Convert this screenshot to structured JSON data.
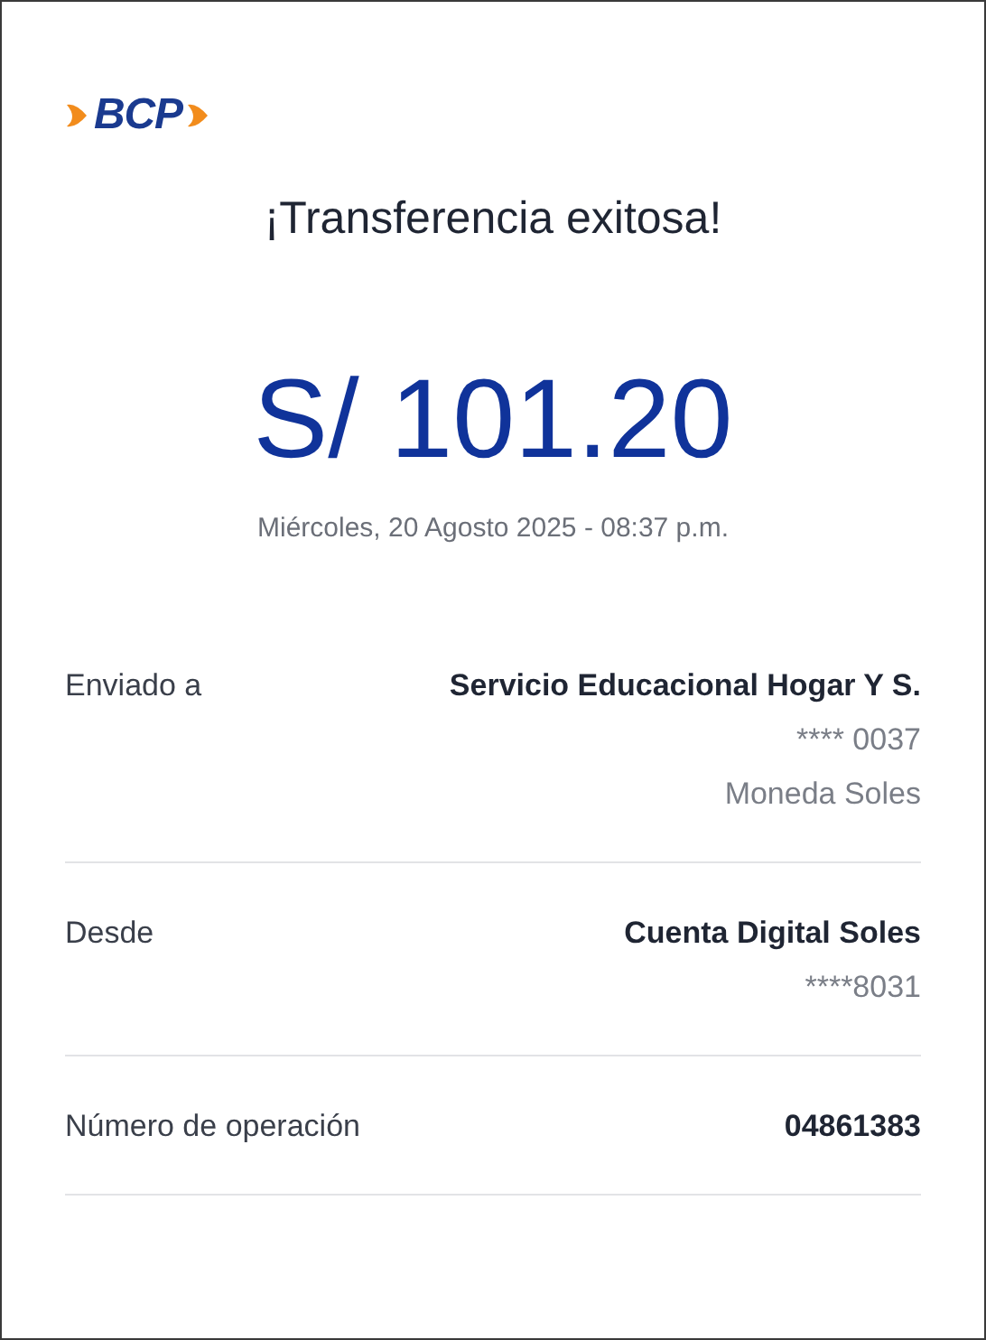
{
  "logo": {
    "text": "BCP"
  },
  "title": "¡Transferencia exitosa!",
  "amount": "S/ 101.20",
  "date": "Miércoles, 20 Agosto 2025 - 08:37 p.m.",
  "details": [
    {
      "label": "Enviado a",
      "values": [
        {
          "text": "Servicio Educacional Hogar Y S.",
          "kind": "primary"
        },
        {
          "text": "**** 0037",
          "kind": "secondary"
        },
        {
          "text": "Moneda Soles",
          "kind": "secondary"
        }
      ]
    },
    {
      "label": "Desde",
      "values": [
        {
          "text": "Cuenta Digital Soles",
          "kind": "primary"
        },
        {
          "text": "****8031",
          "kind": "secondary"
        }
      ]
    },
    {
      "label": "Número de operación",
      "values": [
        {
          "text": "04861383",
          "kind": "primary"
        }
      ]
    }
  ]
}
